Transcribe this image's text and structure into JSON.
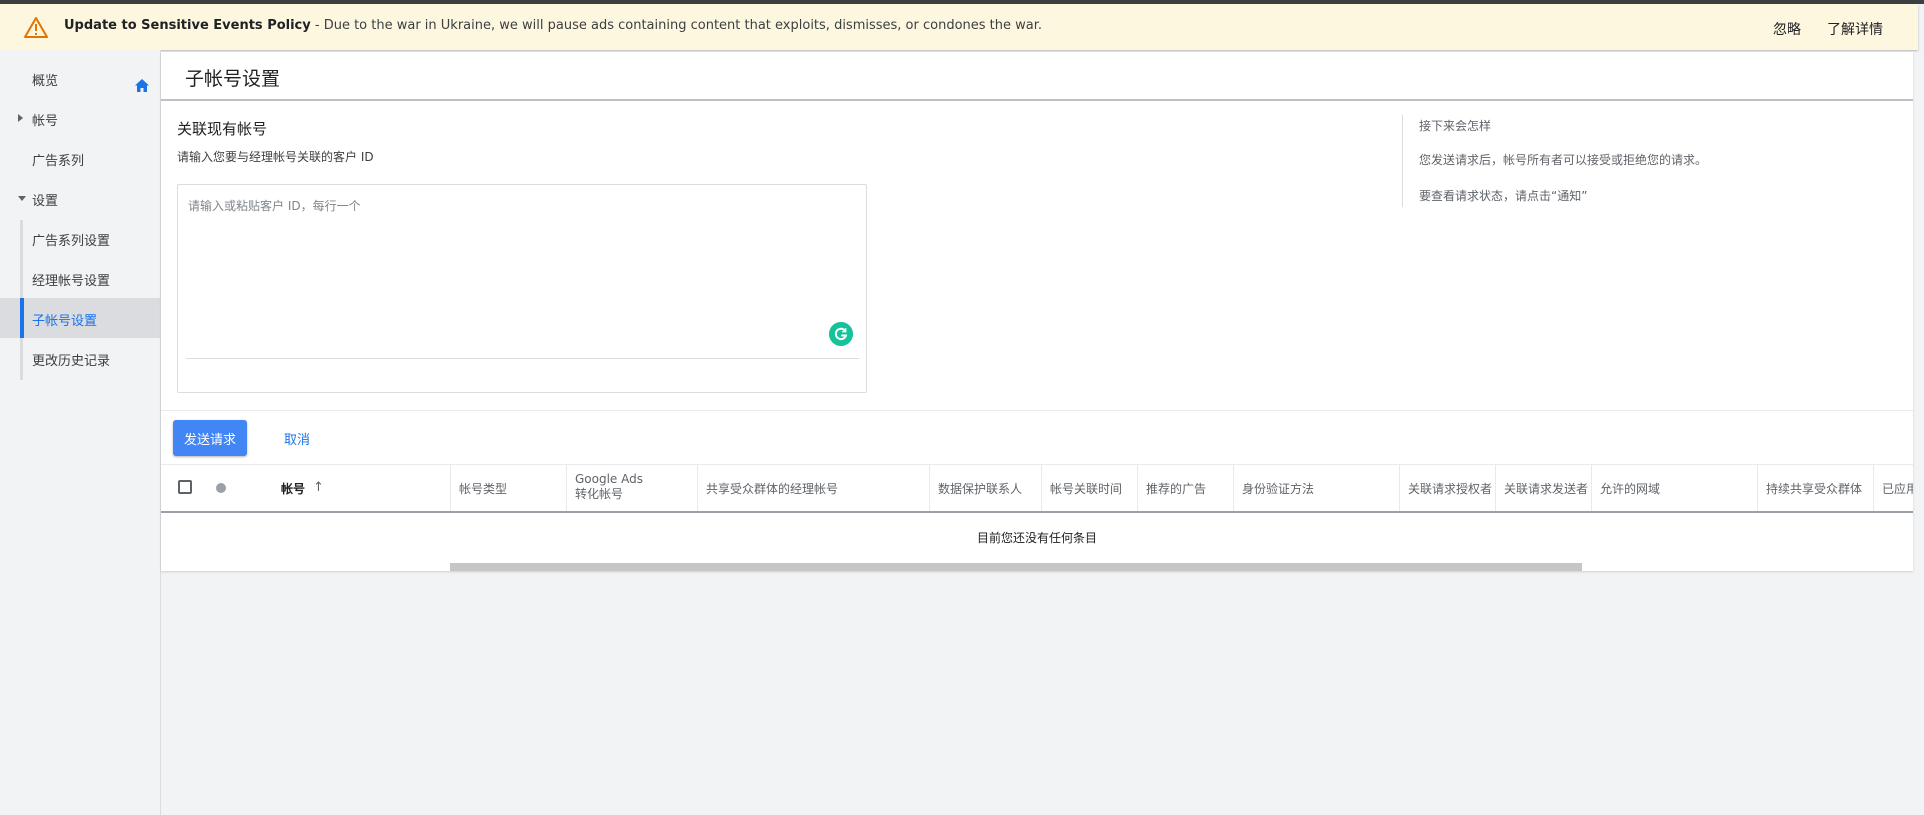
{
  "banner": {
    "title": "Update to Sensitive Events Policy",
    "message": " - Due to the war in Ukraine, we will pause ads containing content that exploits, dismisses, or condones the war.",
    "dismiss_label": "忽略",
    "learn_more_label": "了解详情"
  },
  "sidebar": {
    "items": [
      {
        "label": "概览"
      },
      {
        "label": "帐号"
      },
      {
        "label": "广告系列"
      },
      {
        "label": "设置"
      },
      {
        "label": "广告系列设置"
      },
      {
        "label": "经理帐号设置"
      },
      {
        "label": "子帐号设置"
      },
      {
        "label": "更改历史记录"
      }
    ]
  },
  "page": {
    "title": "子帐号设置",
    "link_section": {
      "title": "关联现有帐号",
      "description": "请输入您要与经理帐号关联的客户 ID",
      "input_placeholder": "请输入或粘贴客户 ID，每行一个",
      "input_value": ""
    },
    "side_note": {
      "heading": "接下来会怎样",
      "line1": "您发送请求后，帐号所有者可以接受或拒绝您的请求。",
      "line2": "要查看请求状态，请点击“通知”"
    },
    "actions": {
      "send_label": "发送请求",
      "cancel_label": "取消"
    },
    "table": {
      "columns": [
        {
          "label": "帐号"
        },
        {
          "label": "帐号类型"
        },
        {
          "label": "Google Ads\n转化帐号"
        },
        {
          "label": "共享受众群体的经理帐号"
        },
        {
          "label": "数据保护联系人"
        },
        {
          "label": "帐号关联时间"
        },
        {
          "label": "推荐的广告"
        },
        {
          "label": "身份验证方法"
        },
        {
          "label": "关联请求授权者"
        },
        {
          "label": "关联请求发送者"
        },
        {
          "label": "允许的网域"
        },
        {
          "label": "持续共享受众群体"
        },
        {
          "label": "已应用"
        }
      ],
      "empty_message": "目前您还没有任何条目"
    }
  },
  "colors": {
    "accent": "#1a73e8",
    "primary_button": "#4285f4",
    "banner_bg": "#fef7e0",
    "warning": "#e37400",
    "grammarly": "#15c39a"
  },
  "icons": {
    "banner": "warning-triangle-icon",
    "overview": "home-icon",
    "collapsed": "caret-right-icon",
    "expanded": "caret-down-icon",
    "sort": "arrow-up-icon",
    "assistant": "grammarly-icon"
  }
}
